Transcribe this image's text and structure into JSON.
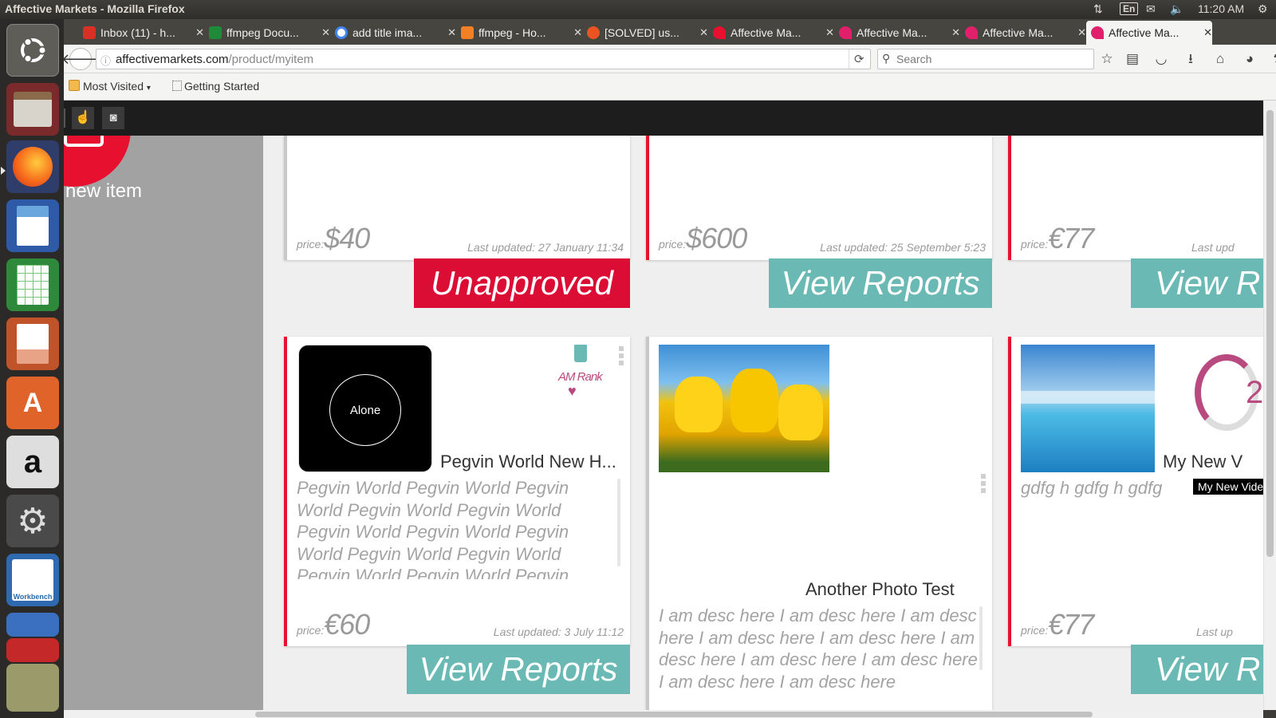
{
  "os": {
    "window_title": "Affective Markets - Mozilla Firefox",
    "lang": "En",
    "time": "11:20 AM"
  },
  "tabs": [
    {
      "label": "Inbox (11) - h...",
      "icon": "gmail-icon",
      "color": "#d93025"
    },
    {
      "label": "ffmpeg Docu...",
      "icon": "ffmpeg-icon",
      "color": "#1f8a3a"
    },
    {
      "label": "add title ima...",
      "icon": "google-icon",
      "color": "#4285f4"
    },
    {
      "label": "ffmpeg - Ho...",
      "icon": "stackoverflow-icon",
      "color": "#f48024"
    },
    {
      "label": "[SOLVED] us...",
      "icon": "ubuntu-forums-icon",
      "color": "#e95420"
    },
    {
      "label": "Affective Ma...",
      "icon": "affective-icon",
      "color": "#e8102f"
    },
    {
      "label": "Affective Ma...",
      "icon": "affective-icon",
      "color": "#e0206a"
    },
    {
      "label": "Affective Ma...",
      "icon": "affective-icon",
      "color": "#e0206a"
    },
    {
      "label": "Affective Ma...",
      "icon": "affective-icon",
      "color": "#e0206a"
    }
  ],
  "nav": {
    "url_domain": "affectivemarkets.com",
    "url_path": "/product/myitem",
    "search_placeholder": "Search"
  },
  "bookmarks": {
    "most_visited": "Most Visited",
    "getting_started": "Getting Started"
  },
  "sidebar": {
    "new_item_label": "new item"
  },
  "colors": {
    "accent_red": "#e8102f",
    "teal": "#6ab9b5",
    "unapproved_red": "#db0d34",
    "rank_pink": "#b94a7f"
  },
  "cards_row1": [
    {
      "price_label": "price:",
      "price": "$40",
      "updated": "Last updated: 27 January 11:34",
      "button": "Unapproved",
      "button_style": "red"
    },
    {
      "price_label": "price:",
      "price": "$600",
      "updated": "Last updated: 25 September 5:23",
      "button": "View Reports",
      "button_style": "teal"
    },
    {
      "price_label": "price:",
      "price": "€77",
      "updated": "Last upd",
      "button": "View R",
      "button_style": "teal"
    }
  ],
  "cards_row2": [
    {
      "thumb_text": "Alone",
      "rank_label": "AM Rank",
      "title": "Pegvin World New H...",
      "desc": "Pegvin World Pegvin World Pegvin World Pegvin World Pegvin World Pegvin World Pegvin World Pegvin World Pegvin World Pegvin World Pegvin World Pegvin World Pegvin World",
      "price_label": "price:",
      "price": "€60",
      "updated": "Last updated: 3 July 11:12",
      "button": "View Reports"
    },
    {
      "title": "Another Photo Test",
      "desc": "I am desc here I am desc here I am desc here I am desc here I am desc here I am desc here I am desc here I am desc here I am desc here I am desc here"
    },
    {
      "rank_value": "2",
      "title": "My New V",
      "tooltip": "My New Video",
      "desc": "gdfg h gdfg h gdfg",
      "price_label": "price:",
      "price": "€77",
      "updated": "Last up",
      "button": "View R"
    }
  ]
}
